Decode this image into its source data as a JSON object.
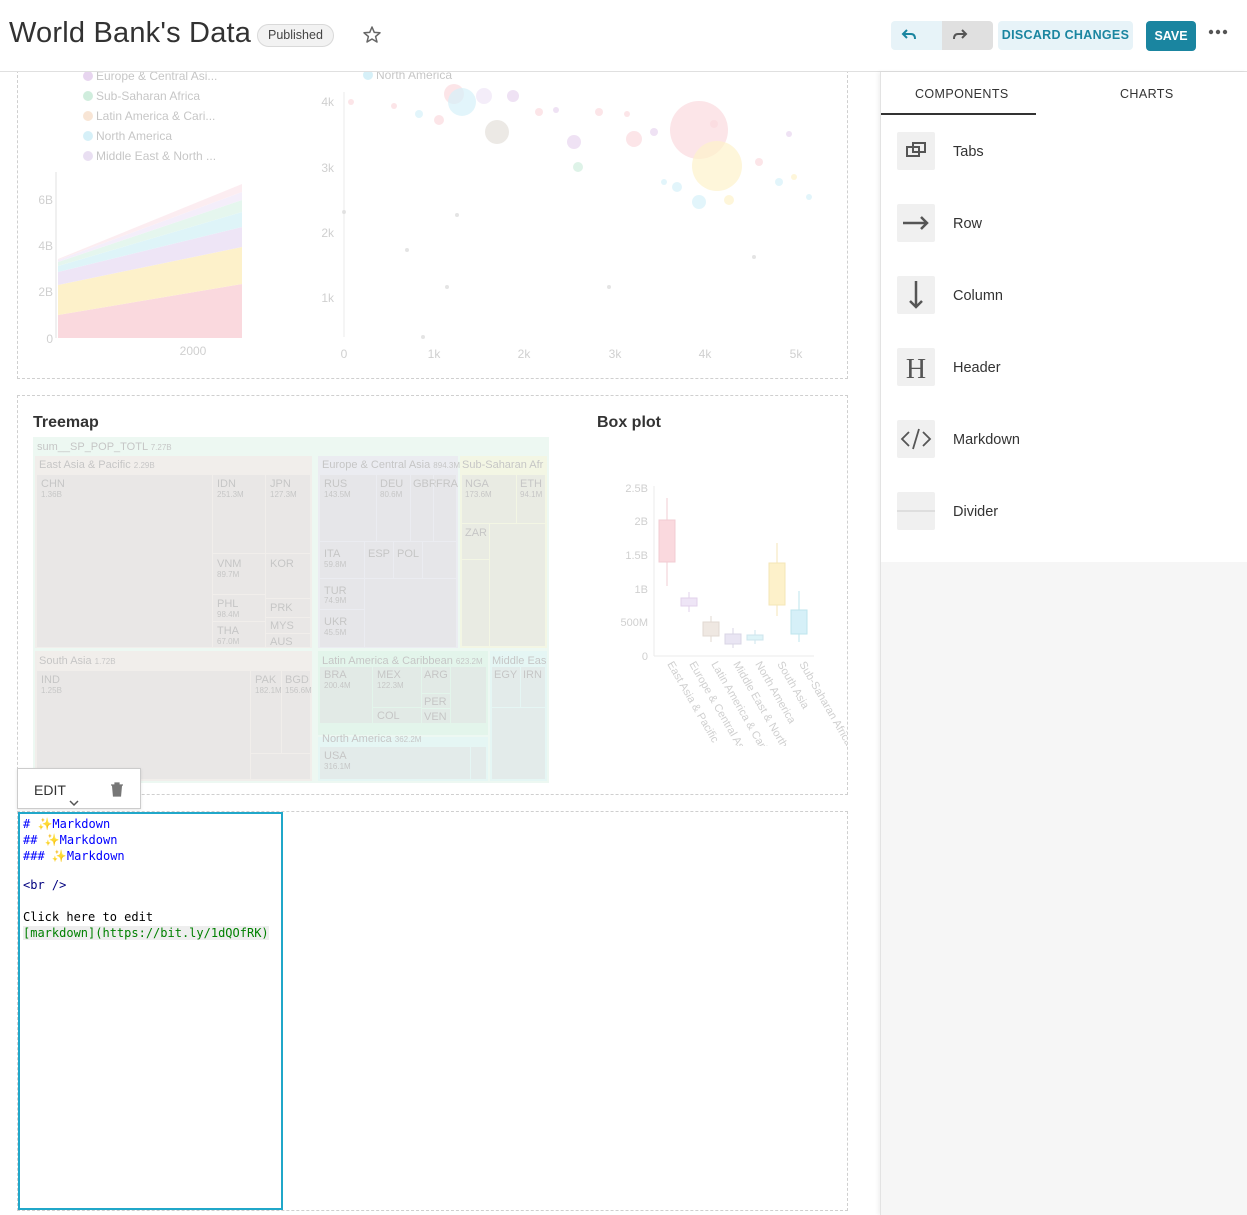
{
  "header": {
    "title": "World Bank's Data",
    "status_badge": "Published",
    "discard_label": "DISCARD CHANGES",
    "save_label": "SAVE",
    "accent_color": "#1a85a0"
  },
  "area_chart": {
    "legend": [
      "Europe & Central Asi...",
      "Sub-Saharan Africa",
      "Latin America & Cari...",
      "North America",
      "Middle East & North ..."
    ],
    "y_ticks": [
      "6B",
      "4B",
      "2B",
      "0"
    ],
    "x_tick": "2000"
  },
  "bubble_chart": {
    "legend": [
      "North America"
    ],
    "y_ticks": [
      "4k",
      "3k",
      "2k",
      "1k"
    ],
    "x_ticks": [
      "0",
      "1k",
      "2k",
      "3k",
      "4k",
      "5k"
    ]
  },
  "treemap": {
    "title": "Treemap",
    "root": "sum__SP_POP_TOTL",
    "root_value": "7.27B",
    "regions": [
      {
        "name": "East Asia & Pacific",
        "value": "2.29B"
      },
      {
        "name": "Europe & Central Asia",
        "value": "894.3M"
      },
      {
        "name": "Sub-Saharan Afr"
      },
      {
        "name": "South Asia",
        "value": "1.72B"
      },
      {
        "name": "Latin America & Caribbean",
        "value": "623.2M"
      },
      {
        "name": "Middle Eas"
      },
      {
        "name": "North America",
        "value": "362.2M"
      }
    ],
    "cells": [
      {
        "name": "CHN",
        "value": "1.36B"
      },
      {
        "name": "IDN",
        "value": "251.3M"
      },
      {
        "name": "JPN",
        "value": "127.3M"
      },
      {
        "name": "VNM",
        "value": "89.7M"
      },
      {
        "name": "KOR"
      },
      {
        "name": "PHL",
        "value": "98.4M"
      },
      {
        "name": "THA",
        "value": "67.0M"
      },
      {
        "name": "PRK"
      },
      {
        "name": "MYS"
      },
      {
        "name": "AUS"
      },
      {
        "name": "RUS",
        "value": "143.5M"
      },
      {
        "name": "DEU",
        "value": "80.6M"
      },
      {
        "name": "GBR"
      },
      {
        "name": "FRA"
      },
      {
        "name": "ITA",
        "value": "59.8M"
      },
      {
        "name": "ESP"
      },
      {
        "name": "POL"
      },
      {
        "name": "TUR",
        "value": "74.9M"
      },
      {
        "name": "UKR",
        "value": "45.5M"
      },
      {
        "name": "NGA",
        "value": "173.6M"
      },
      {
        "name": "ETH",
        "value": "94.1M"
      },
      {
        "name": "ZAR"
      },
      {
        "name": "IND",
        "value": "1.25B"
      },
      {
        "name": "PAK",
        "value": "182.1M"
      },
      {
        "name": "BGD",
        "value": "156.6M"
      },
      {
        "name": "BRA",
        "value": "200.4M"
      },
      {
        "name": "MEX",
        "value": "122.3M"
      },
      {
        "name": "ARG"
      },
      {
        "name": "COL"
      },
      {
        "name": "PER"
      },
      {
        "name": "VEN"
      },
      {
        "name": "EGY"
      },
      {
        "name": "IRN"
      },
      {
        "name": "USA",
        "value": "316.1M"
      }
    ]
  },
  "boxplot": {
    "title": "Box plot",
    "y_ticks": [
      "2.5B",
      "2B",
      "1.5B",
      "1B",
      "500M",
      "0"
    ],
    "categories": [
      "East Asia & Pacific",
      "Europe & Central Asia",
      "Latin America & Caribbean",
      "Middle East & North Africa",
      "North America",
      "South Asia",
      "Sub-Saharan Africa"
    ]
  },
  "edit_popover": {
    "label": "EDIT"
  },
  "markdown_editor": {
    "lines": [
      "# ✨Markdown",
      "## ✨Markdown",
      "### ✨Markdown",
      "",
      "<br />",
      "",
      "Click here to edit",
      "[markdown](https://bit.ly/1dQOfRK)"
    ]
  },
  "sidebar": {
    "tabs": [
      "COMPONENTS",
      "CHARTS"
    ],
    "components": [
      {
        "label": "Tabs",
        "icon": "tabs-icon"
      },
      {
        "label": "Row",
        "icon": "row-arrow-icon"
      },
      {
        "label": "Column",
        "icon": "column-arrow-icon"
      },
      {
        "label": "Header",
        "icon": "header-icon"
      },
      {
        "label": "Markdown",
        "icon": "code-icon"
      },
      {
        "label": "Divider",
        "icon": "divider-icon"
      }
    ]
  }
}
